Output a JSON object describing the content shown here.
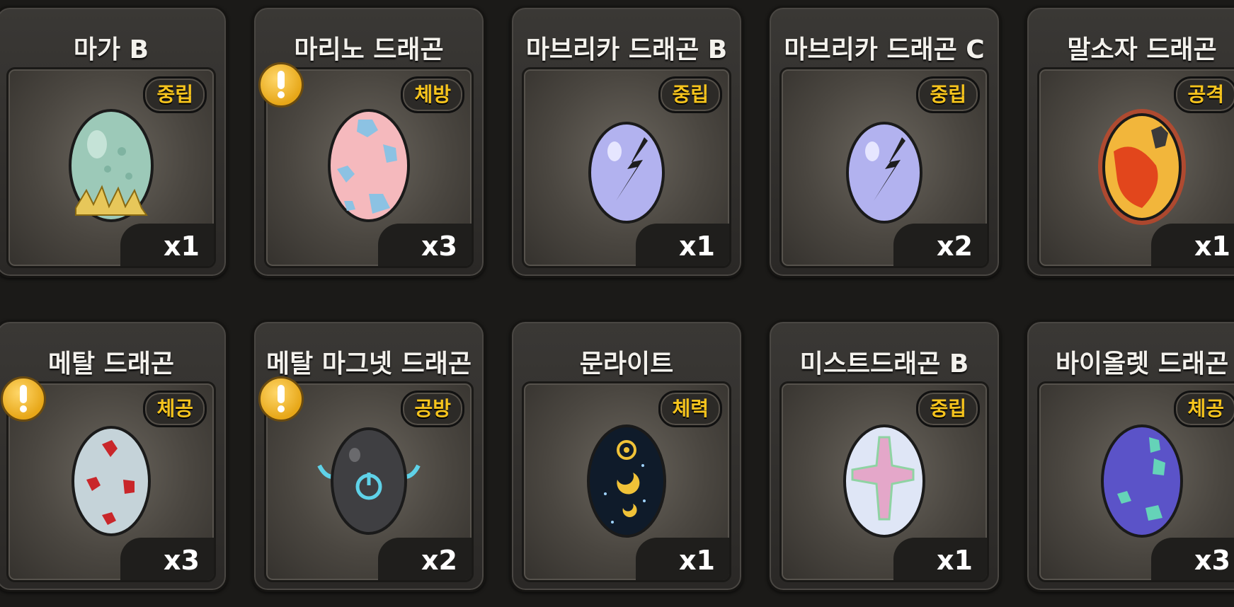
{
  "cards": [
    {
      "name": "마가 B",
      "badge": "중립",
      "count": "x1",
      "icon": "egg-maga-b-icon",
      "alert": false
    },
    {
      "name": "마리노 드래곤",
      "badge": "체방",
      "count": "x3",
      "icon": "egg-marino-dragon-icon",
      "alert": true
    },
    {
      "name": "마브리카 드래곤 B",
      "badge": "중립",
      "count": "x1",
      "icon": "egg-mabrika-dragon-b-icon",
      "alert": false
    },
    {
      "name": "마브리카 드래곤 C",
      "badge": "중립",
      "count": "x2",
      "icon": "egg-mabrika-dragon-c-icon",
      "alert": false
    },
    {
      "name": "말소자 드래곤",
      "badge": "공격",
      "count": "x1",
      "icon": "egg-malsoja-dragon-icon",
      "alert": false
    },
    {
      "name": "메탈 드래곤",
      "badge": "체공",
      "count": "x3",
      "icon": "egg-metal-dragon-icon",
      "alert": true
    },
    {
      "name": "메탈 마그넷 드래곤",
      "badge": "공방",
      "count": "x2",
      "icon": "egg-metal-magnet-dragon-icon",
      "alert": true
    },
    {
      "name": "문라이트",
      "badge": "체력",
      "count": "x1",
      "icon": "egg-moonlight-icon",
      "alert": false
    },
    {
      "name": "미스트드래곤 B",
      "badge": "중립",
      "count": "x1",
      "icon": "egg-mist-dragon-b-icon",
      "alert": false
    },
    {
      "name": "바이올렛 드래곤",
      "badge": "체공",
      "count": "x3",
      "icon": "egg-violet-dragon-icon",
      "alert": false
    }
  ],
  "colors": {
    "badge_text": "#f6c41d",
    "alert": "#e7a718"
  }
}
